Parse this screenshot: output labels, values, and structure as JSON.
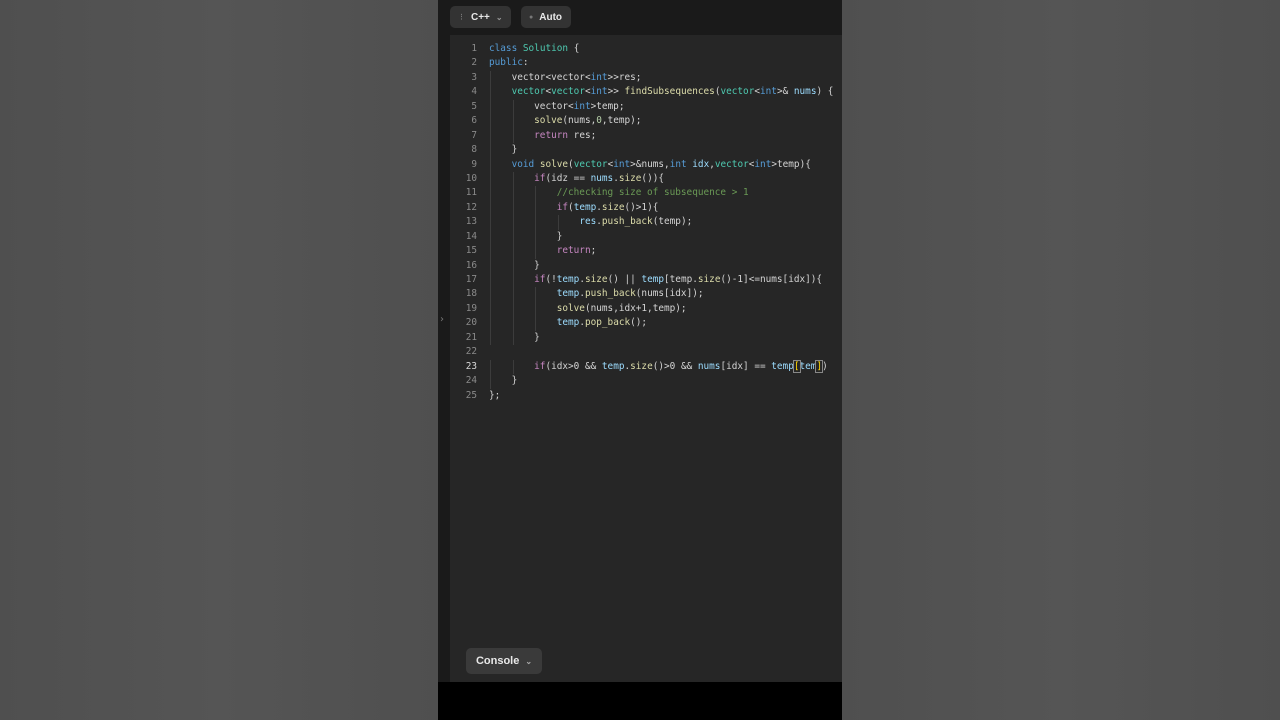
{
  "toolbar": {
    "language": "C++",
    "mode": "Auto"
  },
  "editor": {
    "active_line": 23,
    "lines": [
      {
        "n": "1",
        "segs": [
          [
            "k",
            "class"
          ],
          [
            "p",
            " "
          ],
          [
            "t",
            "Solution"
          ],
          [
            "p",
            " {"
          ]
        ]
      },
      {
        "n": "2",
        "segs": [
          [
            "k",
            "public"
          ],
          [
            "p",
            ":"
          ]
        ]
      },
      {
        "n": "3",
        "segs": [
          [
            "p",
            "    vector<vector<"
          ],
          [
            "k",
            "int"
          ],
          [
            "p",
            ">>res;"
          ]
        ]
      },
      {
        "n": "4",
        "segs": [
          [
            "p",
            "    "
          ],
          [
            "t",
            "vector"
          ],
          [
            "p",
            "<"
          ],
          [
            "t",
            "vector"
          ],
          [
            "p",
            "<"
          ],
          [
            "k",
            "int"
          ],
          [
            "p",
            ">> "
          ],
          [
            "f",
            "findSubsequences"
          ],
          [
            "p",
            "("
          ],
          [
            "t",
            "vector"
          ],
          [
            "p",
            "<"
          ],
          [
            "k",
            "int"
          ],
          [
            "p",
            ">& "
          ],
          [
            "v",
            "nums"
          ],
          [
            "p",
            ") {"
          ]
        ]
      },
      {
        "n": "5",
        "segs": [
          [
            "p",
            "        vector<"
          ],
          [
            "k",
            "int"
          ],
          [
            "p",
            ">temp;"
          ]
        ]
      },
      {
        "n": "6",
        "segs": [
          [
            "p",
            "        "
          ],
          [
            "f",
            "solve"
          ],
          [
            "p",
            "(nums,"
          ],
          [
            "n",
            "0"
          ],
          [
            "p",
            ",temp);"
          ]
        ]
      },
      {
        "n": "7",
        "segs": [
          [
            "p",
            "        "
          ],
          [
            "ctl",
            "return"
          ],
          [
            "p",
            " res;"
          ]
        ]
      },
      {
        "n": "8",
        "segs": [
          [
            "p",
            "    }"
          ]
        ]
      },
      {
        "n": "9",
        "segs": [
          [
            "p",
            "    "
          ],
          [
            "k",
            "void"
          ],
          [
            "p",
            " "
          ],
          [
            "f",
            "solve"
          ],
          [
            "p",
            "("
          ],
          [
            "t",
            "vector"
          ],
          [
            "p",
            "<"
          ],
          [
            "k",
            "int"
          ],
          [
            "p",
            ">&nums,"
          ],
          [
            "k",
            "int"
          ],
          [
            "p",
            " "
          ],
          [
            "v",
            "idx"
          ],
          [
            "p",
            ","
          ],
          [
            "t",
            "vector"
          ],
          [
            "p",
            "<"
          ],
          [
            "k",
            "int"
          ],
          [
            "p",
            ">temp){"
          ]
        ]
      },
      {
        "n": "10",
        "segs": [
          [
            "p",
            "        "
          ],
          [
            "ctl",
            "if"
          ],
          [
            "p",
            "(idz == "
          ],
          [
            "v",
            "nums"
          ],
          [
            "p",
            "."
          ],
          [
            "f",
            "size"
          ],
          [
            "p",
            "()){"
          ]
        ]
      },
      {
        "n": "11",
        "segs": [
          [
            "p",
            "            "
          ],
          [
            "c",
            "//checking size of subsequence > 1"
          ]
        ]
      },
      {
        "n": "12",
        "segs": [
          [
            "p",
            "            "
          ],
          [
            "ctl",
            "if"
          ],
          [
            "p",
            "("
          ],
          [
            "v",
            "temp"
          ],
          [
            "p",
            "."
          ],
          [
            "f",
            "size"
          ],
          [
            "p",
            "()>1){"
          ]
        ]
      },
      {
        "n": "13",
        "segs": [
          [
            "p",
            "                "
          ],
          [
            "v",
            "res"
          ],
          [
            "p",
            "."
          ],
          [
            "f",
            "push_back"
          ],
          [
            "p",
            "(temp);"
          ]
        ]
      },
      {
        "n": "14",
        "segs": [
          [
            "p",
            "            }"
          ]
        ]
      },
      {
        "n": "15",
        "segs": [
          [
            "p",
            "            "
          ],
          [
            "ctl",
            "return"
          ],
          [
            "p",
            ";"
          ]
        ]
      },
      {
        "n": "16",
        "segs": [
          [
            "p",
            "        }"
          ]
        ]
      },
      {
        "n": "17",
        "segs": [
          [
            "p",
            "        "
          ],
          [
            "ctl",
            "if"
          ],
          [
            "p",
            "(!"
          ],
          [
            "v",
            "temp"
          ],
          [
            "p",
            "."
          ],
          [
            "f",
            "size"
          ],
          [
            "p",
            "() || "
          ],
          [
            "v",
            "temp"
          ],
          [
            "p",
            "[temp."
          ],
          [
            "f",
            "size"
          ],
          [
            "p",
            "()-1]<=nums[idx]){"
          ]
        ]
      },
      {
        "n": "18",
        "segs": [
          [
            "p",
            "            "
          ],
          [
            "v",
            "temp"
          ],
          [
            "p",
            "."
          ],
          [
            "f",
            "push_back"
          ],
          [
            "p",
            "(nums[idx]);"
          ]
        ]
      },
      {
        "n": "19",
        "segs": [
          [
            "p",
            "            "
          ],
          [
            "f",
            "solve"
          ],
          [
            "p",
            "(nums,idx+1,temp);"
          ]
        ]
      },
      {
        "n": "20",
        "segs": [
          [
            "p",
            "            "
          ],
          [
            "v",
            "temp"
          ],
          [
            "p",
            "."
          ],
          [
            "f",
            "pop_back"
          ],
          [
            "p",
            "();"
          ]
        ]
      },
      {
        "n": "21",
        "segs": [
          [
            "p",
            "        }"
          ]
        ]
      },
      {
        "n": "22",
        "segs": []
      },
      {
        "n": "23",
        "segs": [
          [
            "p",
            "        "
          ],
          [
            "ctl",
            "if"
          ],
          [
            "p",
            "(idx>0 && "
          ],
          [
            "v",
            "temp"
          ],
          [
            "p",
            "."
          ],
          [
            "f",
            "size"
          ],
          [
            "p",
            "()>0 && "
          ],
          [
            "v",
            "nums"
          ],
          [
            "p",
            "[idx] == "
          ],
          [
            "v",
            "temp"
          ],
          [
            "br",
            "["
          ],
          [
            "v",
            "tem"
          ],
          [
            "br",
            "]"
          ],
          [
            "p",
            ")"
          ]
        ]
      },
      {
        "n": "24",
        "segs": [
          [
            "p",
            "    }"
          ]
        ]
      },
      {
        "n": "25",
        "segs": [
          [
            "p",
            "};"
          ]
        ]
      }
    ]
  },
  "console": {
    "label": "Console"
  }
}
